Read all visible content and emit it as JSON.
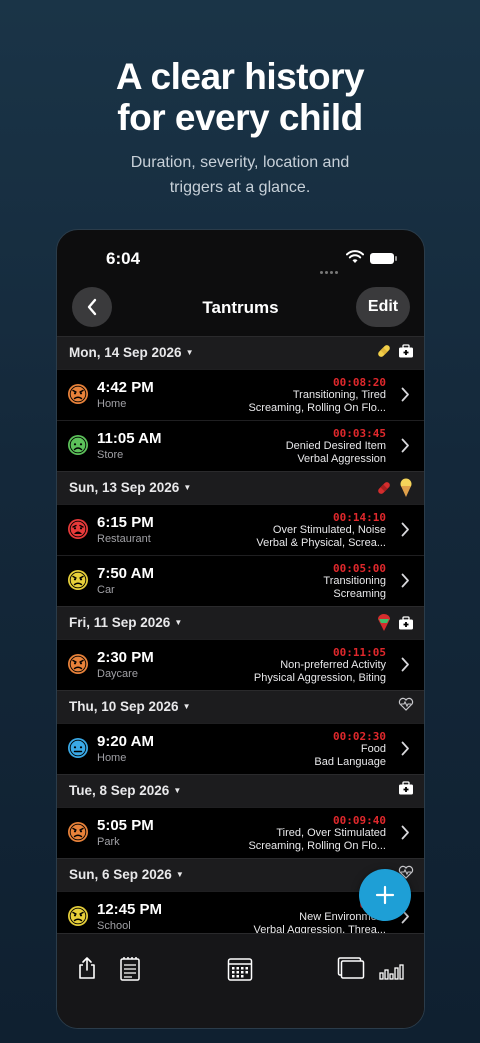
{
  "promo": {
    "headline_line1": "A clear history",
    "headline_line2": "for every child",
    "sub_line1": "Duration, severity, location and",
    "sub_line2": "triggers at a glance."
  },
  "status_bar": {
    "time": "6:04"
  },
  "nav": {
    "title": "Tantrums",
    "edit_label": "Edit"
  },
  "days": [
    {
      "label": "Mon, 14 Sep 2026",
      "icons": [
        "bandage-icon",
        "first-aid-kit-icon"
      ],
      "entries": [
        {
          "time": "4:42 PM",
          "location": "Home",
          "duration": "00:08:20",
          "line1": "Transitioning, Tired",
          "line2": "Screaming, Rolling On Flo...",
          "face_color": "#e8823a",
          "face": "angry"
        },
        {
          "time": "11:05 AM",
          "location": "Store",
          "duration": "00:03:45",
          "line1": "Denied Desired Item",
          "line2": "Verbal Aggression",
          "face_color": "#5cc25a",
          "face": "frown"
        }
      ]
    },
    {
      "label": "Sun, 13 Sep 2026",
      "icons": [
        "red-bandage-icon",
        "ice-cream-icon"
      ],
      "entries": [
        {
          "time": "6:15 PM",
          "location": "Restaurant",
          "duration": "00:14:10",
          "line1": "Over Stimulated, Noise",
          "line2": "Verbal & Physical, Screa...",
          "face_color": "#e63a3a",
          "face": "crying"
        },
        {
          "time": "7:50 AM",
          "location": "Car",
          "duration": "00:05:00",
          "line1": "Transitioning",
          "line2": "Screaming",
          "face_color": "#e6cf3a",
          "face": "angry"
        }
      ]
    },
    {
      "label": "Fri, 11 Sep 2026",
      "icons": [
        "ice-pop-icon",
        "first-aid-kit-icon"
      ],
      "entries": [
        {
          "time": "2:30 PM",
          "location": "Daycare",
          "duration": "00:11:05",
          "line1": "Non-preferred Activity",
          "line2": "Physical Aggression, Biting",
          "face_color": "#e8823a",
          "face": "angry"
        }
      ]
    },
    {
      "label": "Thu, 10 Sep 2026",
      "icons": [
        "heartbeat-icon"
      ],
      "entries": [
        {
          "time": "9:20 AM",
          "location": "Home",
          "duration": "00:02:30",
          "line1": "Food",
          "line2": "Bad Language",
          "face_color": "#3aa9e6",
          "face": "neutral"
        }
      ]
    },
    {
      "label": "Tue, 8 Sep 2026",
      "icons": [
        "first-aid-kit-icon"
      ],
      "entries": [
        {
          "time": "5:05 PM",
          "location": "Park",
          "duration": "00:09:40",
          "line1": "Tired, Over Stimulated",
          "line2": "Screaming, Rolling On Flo...",
          "face_color": "#e8823a",
          "face": "angry"
        }
      ]
    },
    {
      "label": "Sun, 6 Sep 2026",
      "icons": [
        "heartbeat-icon"
      ],
      "entries": [
        {
          "time": "12:45 PM",
          "location": "School",
          "duration": "00:0",
          "line1": "New Environment",
          "line2": "Verbal Aggression, Threa...",
          "face_color": "#e6cf3a",
          "face": "angry"
        }
      ]
    }
  ],
  "tabbar": {
    "icons": [
      "share-icon",
      "notes-icon",
      "calendar-icon",
      "cards-icon",
      "bar-chart-icon"
    ]
  },
  "fab": {
    "icon": "plus-icon",
    "color": "#1e9fd6"
  }
}
